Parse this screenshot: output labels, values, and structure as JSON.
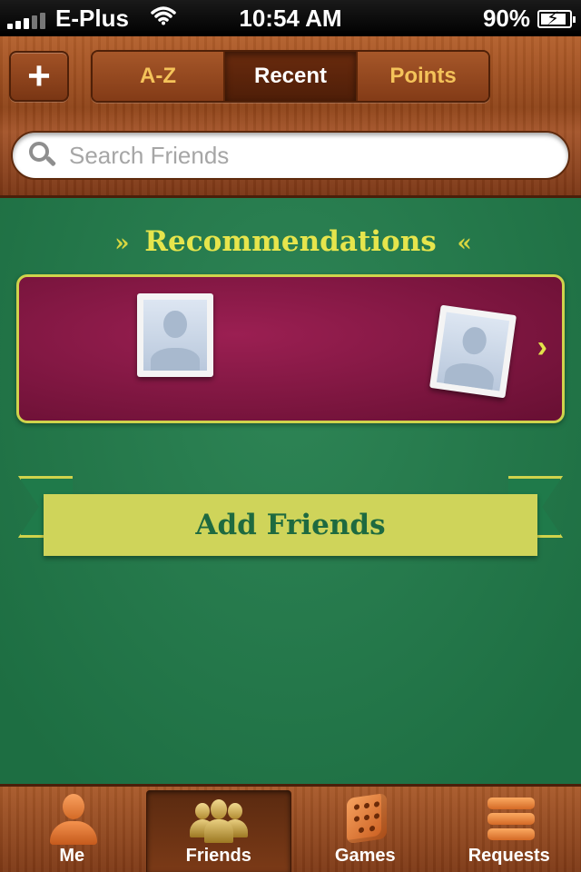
{
  "status_bar": {
    "carrier": "E-Plus",
    "time": "10:54 AM",
    "battery": "90%",
    "battery_level": 0.9
  },
  "header": {
    "add_label": "+",
    "segments": [
      {
        "label": "A-Z",
        "active": false
      },
      {
        "label": "Recent",
        "active": true
      },
      {
        "label": "Points",
        "active": false
      }
    ],
    "search_placeholder": "Search Friends"
  },
  "recommendations": {
    "title": "Recommendations",
    "chevron": "›"
  },
  "add_friends": {
    "label": "Add Friends"
  },
  "tabbar": {
    "tabs": [
      {
        "label": "Me",
        "icon": "person-icon",
        "active": false
      },
      {
        "label": "Friends",
        "icon": "friends-icon",
        "active": true
      },
      {
        "label": "Games",
        "icon": "dice-icon",
        "active": false
      },
      {
        "label": "Requests",
        "icon": "requests-icon",
        "active": false
      }
    ]
  },
  "colors": {
    "felt": "#217d4b",
    "accent_yellow": "#e6e54c",
    "card_magenta": "#8a1946",
    "wood": "#9b4f22"
  }
}
